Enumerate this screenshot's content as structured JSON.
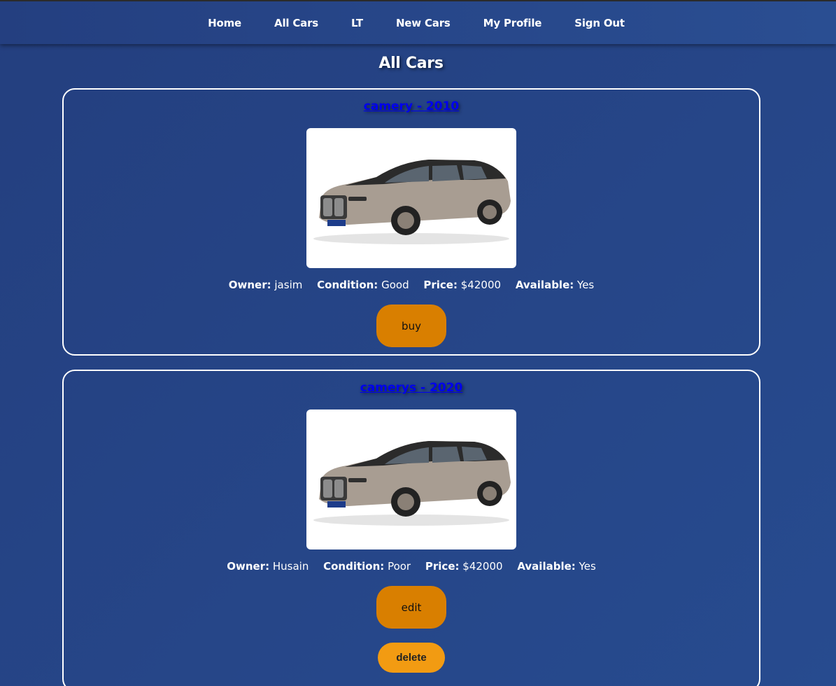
{
  "nav": {
    "items": [
      {
        "label": "Home"
      },
      {
        "label": "All Cars"
      },
      {
        "label": "LT"
      },
      {
        "label": "New Cars"
      },
      {
        "label": "My Profile"
      },
      {
        "label": "Sign Out"
      }
    ]
  },
  "page": {
    "title": "All Cars"
  },
  "cars": [
    {
      "title": "camery - 2010",
      "owner_label": "Owner:",
      "owner": "jasim",
      "condition_label": "Condition:",
      "condition": "Good",
      "price_label": "Price:",
      "price": "$42000",
      "available_label": "Available:",
      "available": "Yes",
      "action_label": "buy"
    },
    {
      "title": "camerys - 2020",
      "owner_label": "Owner:",
      "owner": "Husain",
      "condition_label": "Condition:",
      "condition": "Poor",
      "price_label": "Price:",
      "price": "$42000",
      "available_label": "Available:",
      "available": "Yes",
      "action_label": "edit",
      "delete_label": "delete"
    }
  ],
  "colors": {
    "background": "#274b8f",
    "link": "#0000ee",
    "button_primary": "#d97f00",
    "button_delete": "#f29b12"
  }
}
